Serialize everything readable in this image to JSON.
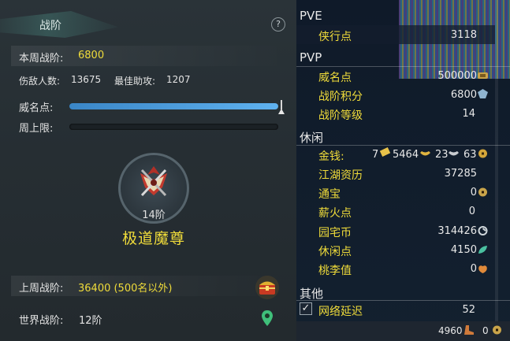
{
  "left_panel": {
    "title": "战阶",
    "help_glyph": "?",
    "weekly_rank_label": "本周战阶:",
    "weekly_rank_value": "6800",
    "enemy_count_label": "伤敌人数:",
    "enemy_count_value": "13675",
    "best_assist_label": "最佳助攻:",
    "best_assist_value": "1207",
    "prestige_label": "威名点:",
    "prestige_progress": 1.0,
    "weekly_cap_label": "周上限:",
    "weekly_cap_progress": 0.0,
    "rank_level": "14阶",
    "rank_name": "极道魔尊",
    "last_week_label": "上周战阶:",
    "last_week_value": "36400 (500名以外)",
    "world_rank_label": "世界战阶:",
    "world_rank_value": "12阶",
    "icons": {
      "help": "help-icon",
      "emblem": "rank-emblem-icon",
      "chest": "treasure-chest-icon",
      "pin": "location-pin-icon"
    }
  },
  "right_panel": {
    "pve": {
      "title": "PVE",
      "items": [
        {
          "label": "侠行点",
          "value": "3118"
        }
      ]
    },
    "pvp": {
      "title": "PVP",
      "items": [
        {
          "label": "威名点",
          "value": "500000"
        },
        {
          "label": "战阶积分",
          "value": "6800"
        },
        {
          "label": "战阶等级",
          "value": "14"
        }
      ]
    },
    "leisure": {
      "title": "休闲",
      "money_label": "金钱:",
      "money_gold": "7",
      "money_silver": "5464",
      "money_copper": "23",
      "money_coin": "63",
      "items": [
        {
          "label": "江湖资历",
          "value": "37285"
        },
        {
          "label": "通宝",
          "value": "0"
        },
        {
          "label": "薪火点",
          "value": "0"
        },
        {
          "label": "园宅币",
          "value": "314426"
        },
        {
          "label": "休闲点",
          "value": "4150"
        },
        {
          "label": "桃李值",
          "value": "0"
        }
      ]
    },
    "other": {
      "title": "其他",
      "latency_label": "网络延迟",
      "latency_value": "52",
      "latency_checked": true,
      "check_glyph": "✓"
    },
    "footer": {
      "value_a": "4960",
      "value_b": "0"
    }
  },
  "colors": {
    "accent_yellow": "#f0dc3a",
    "bar_blue": "#4a9ee0",
    "panel_dark": "#13202f"
  }
}
